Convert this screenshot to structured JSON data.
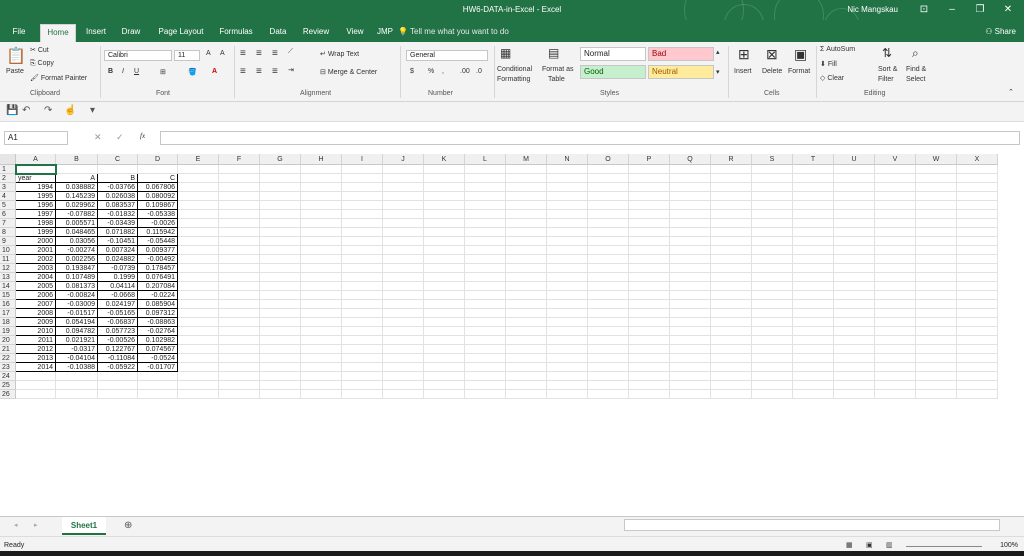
{
  "window": {
    "title": "HW6-DATA-in-Excel  -  Excel",
    "user": "Nic Mangskau"
  },
  "tabs": [
    "File",
    "Home",
    "Insert",
    "Draw",
    "Page Layout",
    "Formulas",
    "Data",
    "Review",
    "View",
    "JMP"
  ],
  "active_tab": "Home",
  "tellme": "Tell me what you want to do",
  "share": "Share",
  "ribbon": {
    "clipboard": {
      "paste": "Paste",
      "cut": "Cut",
      "copy": "Copy",
      "format_painter": "Format Painter",
      "label": "Clipboard"
    },
    "font": {
      "name": "Calibri",
      "size": "11",
      "bold": "B",
      "italic": "I",
      "underline": "U",
      "grow": "A",
      "shrink": "A",
      "label": "Font"
    },
    "alignment": {
      "wrap": "Wrap Text",
      "merge": "Merge & Center",
      "label": "Alignment"
    },
    "number": {
      "format": "General",
      "currency": "$",
      "percent": "%",
      "comma": ",",
      "inc_decimal": ".00",
      "dec_decimal": ".0",
      "label": "Number"
    },
    "styles": {
      "conditional": "Conditional",
      "formatting": "Formatting",
      "format_as": "Format as",
      "table": "Table",
      "normal": "Normal",
      "bad": "Bad",
      "good": "Good",
      "neutral": "Neutral",
      "label": "Styles"
    },
    "cells": {
      "insert": "Insert",
      "delete": "Delete",
      "format": "Format",
      "label": "Cells"
    },
    "editing": {
      "autosum": "AutoSum",
      "fill": "Fill",
      "clear": "Clear",
      "sort": "Sort &",
      "filter": "Filter",
      "find": "Find &",
      "select": "Select",
      "label": "Editing"
    }
  },
  "formula_bar": {
    "name_box": "A1",
    "fx": "fx",
    "value": ""
  },
  "columns": [
    "A",
    "B",
    "C",
    "D",
    "E",
    "F",
    "G",
    "H",
    "I",
    "J",
    "K",
    "L",
    "M",
    "N",
    "O",
    "P",
    "Q",
    "R",
    "S",
    "T",
    "U",
    "V",
    "W",
    "X"
  ],
  "rows": [
    "1",
    "2",
    "3",
    "4",
    "5",
    "6",
    "7",
    "8",
    "9",
    "10",
    "11",
    "12",
    "13",
    "14",
    "15",
    "16",
    "17",
    "18",
    "19",
    "20",
    "21",
    "22",
    "23",
    "24",
    "25",
    "26"
  ],
  "table": {
    "headers": [
      "year",
      "A",
      "B",
      "C"
    ],
    "data": [
      [
        "1994",
        "0.038882",
        "-0.03766",
        "0.067806"
      ],
      [
        "1995",
        "0.145239",
        "0.026038",
        "0.080092"
      ],
      [
        "1996",
        "0.029962",
        "0.083537",
        "0.109867"
      ],
      [
        "1997",
        "-0.07882",
        "-0.01832",
        "-0.05338"
      ],
      [
        "1998",
        "0.005571",
        "-0.03439",
        "-0.0026"
      ],
      [
        "1999",
        "0.048465",
        "0.071882",
        "0.115942"
      ],
      [
        "2000",
        "0.03056",
        "-0.10451",
        "-0.05448"
      ],
      [
        "2001",
        "-0.00274",
        "0.007324",
        "0.009377"
      ],
      [
        "2002",
        "0.002256",
        "0.024882",
        "-0.00492"
      ],
      [
        "2003",
        "0.193847",
        "-0.0739",
        "0.178457"
      ],
      [
        "2004",
        "0.107489",
        "0.1999",
        "0.076491"
      ],
      [
        "2005",
        "0.081373",
        "0.04114",
        "0.207084"
      ],
      [
        "2006",
        "-0.00824",
        "-0.0668",
        "-0.0224"
      ],
      [
        "2007",
        "-0.03009",
        "0.024197",
        "0.085904"
      ],
      [
        "2008",
        "-0.01517",
        "-0.05165",
        "0.097312"
      ],
      [
        "2009",
        "0.054194",
        "-0.06837",
        "-0.08863"
      ],
      [
        "2010",
        "0.094782",
        "0.057723",
        "-0.02764"
      ],
      [
        "2011",
        "0.021921",
        "-0.00526",
        "0.102982"
      ],
      [
        "2012",
        "-0.0317",
        "0.122767",
        "0.074567"
      ],
      [
        "2013",
        "-0.04104",
        "-0.11084",
        "-0.0524"
      ],
      [
        "2014",
        "-0.10388",
        "-0.05922",
        "-0.01707"
      ]
    ]
  },
  "sheet_tabs": [
    "Sheet1"
  ],
  "status": {
    "ready": "Ready",
    "zoom": "100%"
  },
  "colors": {
    "accent": "#217346",
    "bad_bg": "#ffc7ce",
    "bad_fg": "#9c0006",
    "good_bg": "#c6efce",
    "good_fg": "#006100",
    "neutral_bg": "#ffeb9c",
    "neutral_fg": "#9c5700"
  }
}
